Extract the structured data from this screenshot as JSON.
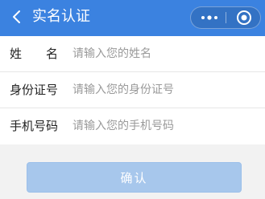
{
  "navbar": {
    "title": "实名认证",
    "background": "#3b82e0",
    "back_icon": "chevron-left-icon",
    "more_icon": "more-dots-icon",
    "close_icon": "target-circle-icon"
  },
  "form": {
    "fields": [
      {
        "label": "姓　　名",
        "placeholder": "请输入您的姓名",
        "value": ""
      },
      {
        "label": "身份证号",
        "placeholder": "请输入您的身份证号",
        "value": ""
      },
      {
        "label": "手机号码",
        "placeholder": "请输入您的手机号码",
        "value": ""
      }
    ]
  },
  "submit": {
    "label": "确认",
    "color": "#a7c7ec"
  }
}
